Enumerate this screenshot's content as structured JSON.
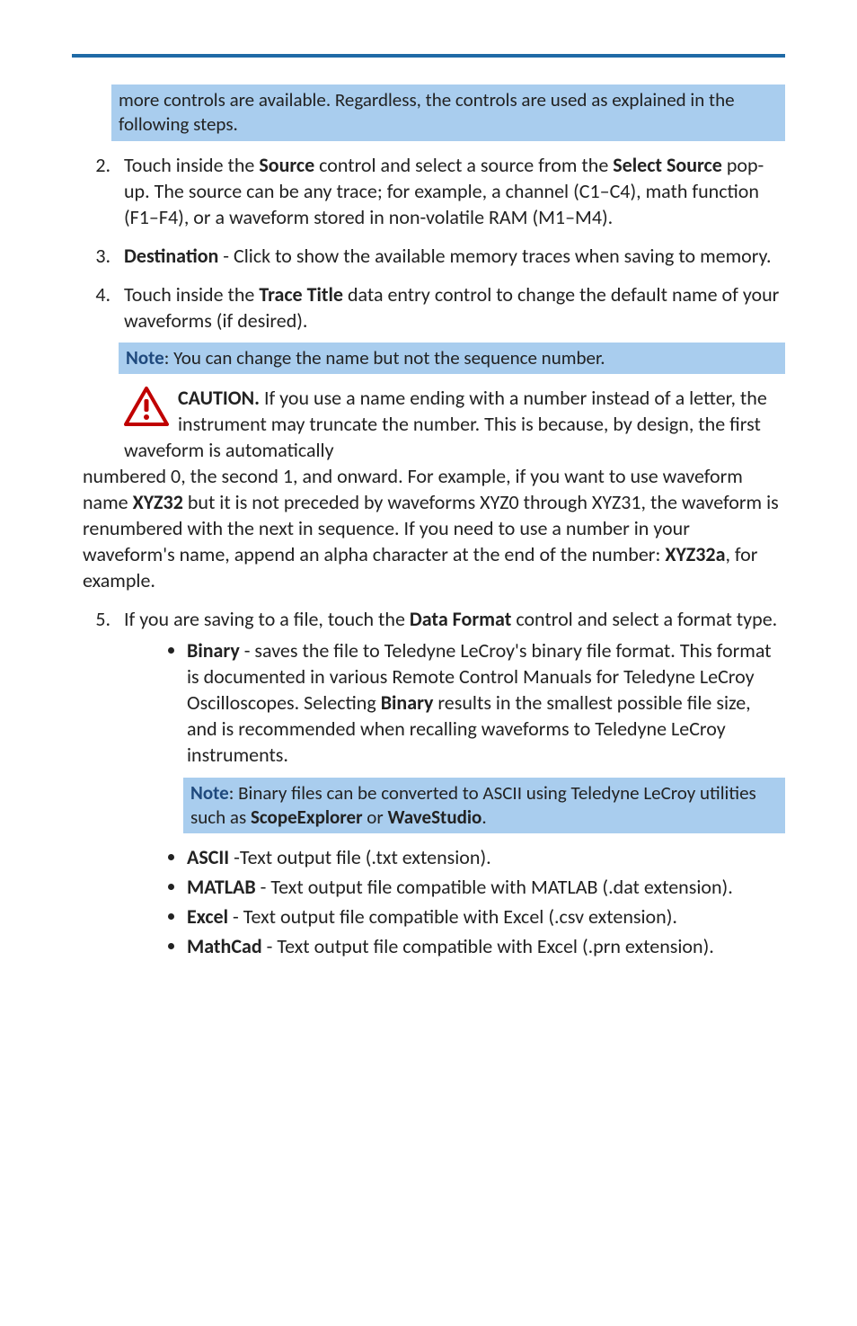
{
  "notes": {
    "top_continuation": "more controls are available. Regardless, the controls are used as explained in the following steps.",
    "note_label": "Note",
    "note_sequence": ": You can change the name but not the sequence number.",
    "note_binary_pre": ": Binary files can be converted to ASCII using Teledyne LeCroy utilities such as ",
    "note_binary_scope": "ScopeExplorer",
    "note_binary_or": " or ",
    "note_binary_wave": "WaveStudio",
    "note_binary_end": "."
  },
  "steps": {
    "s2_pre": "Touch inside the ",
    "s2_source": "Source",
    "s2_mid1": " control and select a source from the ",
    "s2_select_source": "Select Source",
    "s2_post": " pop-up. The source can be any trace; for example, a channel (C1–C4), math function (F1–F4), or a waveform stored in non-volatile RAM (M1–M4).",
    "s3_dest": "Destination",
    "s3_post": " - Click to show the available memory traces when saving to memory.",
    "s4_pre": "Touch inside the ",
    "s4_title": "Trace Title",
    "s4_post": " data entry control to change the default name of your waveforms (if desired).",
    "s5_pre": "If you are saving to a file, touch the ",
    "s5_df": "Data Format",
    "s5_post": " control and select a format type."
  },
  "caution": {
    "label": "CAUTION.",
    "line1": " If you use a name ending with a number instead of a letter, the instrument may truncate the number. This is because, by design, the first waveform is automatically ",
    "line2_pre": "numbered 0, the second 1, and onward. For example, if you want to use waveform name ",
    "xyz32": "XYZ32",
    "line2_mid": " but it is not preceded by waveforms XYZ0 through XYZ31, the waveform is renumbered with the next in sequence. If you need to use a number in your waveform's name, append an alpha character at the end of the number: ",
    "xyz32a": "XYZ32a",
    "line2_end": ", for example."
  },
  "formats": {
    "binary_label": "Binary",
    "binary_text_pre": " - saves the file to Teledyne LeCroy's binary file format. This format is documented in various Remote Control Manuals for Teledyne LeCroy Oscilloscopes. Selecting ",
    "binary_text_bold": "Binary",
    "binary_text_post": " results in the smallest possible file size, and is recommended when recalling waveforms to Teledyne LeCroy instruments.",
    "ascii_label": "ASCII",
    "ascii_text": " -Text output file (.txt extension).",
    "matlab_label": "MATLAB",
    "matlab_text": " - Text output file compatible with MATLAB (.dat extension).",
    "excel_label": "Excel",
    "excel_text": " - Text output file compatible with Excel (.csv extension).",
    "mathcad_label": "MathCad",
    "mathcad_text": " - Text output file compatible with Excel (.prn extension)."
  }
}
